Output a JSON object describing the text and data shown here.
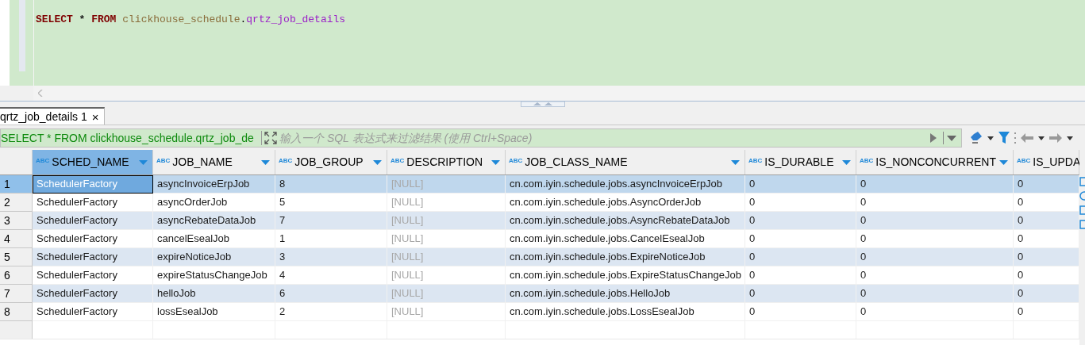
{
  "editor": {
    "tokens": [
      {
        "text": "SELECT ",
        "kind": "keyword"
      },
      {
        "text": "* ",
        "kind": "operator"
      },
      {
        "text": "FROM ",
        "kind": "keyword"
      },
      {
        "text": "clickhouse_schedule",
        "kind": "schema"
      },
      {
        "text": ".",
        "kind": "punct"
      },
      {
        "text": "qrtz_job_details",
        "kind": "table"
      }
    ]
  },
  "result_tabs": [
    {
      "label": "qrtz_job_details 1",
      "selected": true,
      "close": "×"
    }
  ],
  "filter": {
    "query": "SELECT * FROM clickhouse_schedule.qrtz_job_de",
    "placeholder": "输入一个 SQL 表达式来过滤结果 (使用 Ctrl+Space)"
  },
  "table": {
    "columns": [
      {
        "type": "ABC",
        "name": "SCHED_NAME",
        "selected": true
      },
      {
        "type": "ABC",
        "name": "JOB_NAME",
        "selected": false
      },
      {
        "type": "ABC",
        "name": "JOB_GROUP",
        "selected": false
      },
      {
        "type": "ABC",
        "name": "DESCRIPTION",
        "selected": false
      },
      {
        "type": "ABC",
        "name": "JOB_CLASS_NAME",
        "selected": false
      },
      {
        "type": "ABC",
        "name": "IS_DURABLE",
        "selected": false
      },
      {
        "type": "ABC",
        "name": "IS_NONCONCURRENT",
        "selected": false
      },
      {
        "type": "ABC",
        "name": "IS_UPDA",
        "selected": false
      }
    ],
    "rows": [
      {
        "number": "1",
        "selected": true,
        "cells": [
          {
            "text": "SchedulerFactory"
          },
          {
            "text": "asyncInvoiceErpJob"
          },
          {
            "text": "8"
          },
          {
            "text": "[NULL]",
            "kind": "null"
          },
          {
            "text": "cn.com.iyin.schedule.jobs.asyncInvoiceErpJob"
          },
          {
            "text": "0"
          },
          {
            "text": "0"
          },
          {
            "text": "0"
          }
        ]
      },
      {
        "number": "2",
        "selected": false,
        "cells": [
          {
            "text": "SchedulerFactory"
          },
          {
            "text": "asyncOrderJob"
          },
          {
            "text": "5"
          },
          {
            "text": "[NULL]",
            "kind": "null"
          },
          {
            "text": "cn.com.iyin.schedule.jobs.AsyncOrderJob"
          },
          {
            "text": "0"
          },
          {
            "text": "0"
          },
          {
            "text": "0"
          }
        ]
      },
      {
        "number": "3",
        "selected": false,
        "cells": [
          {
            "text": "SchedulerFactory"
          },
          {
            "text": "asyncRebateDataJob"
          },
          {
            "text": "7"
          },
          {
            "text": "[NULL]",
            "kind": "null"
          },
          {
            "text": "cn.com.iyin.schedule.jobs.AsyncRebateDataJob"
          },
          {
            "text": "0"
          },
          {
            "text": "0"
          },
          {
            "text": "0"
          }
        ]
      },
      {
        "number": "4",
        "selected": false,
        "cells": [
          {
            "text": "SchedulerFactory"
          },
          {
            "text": "cancelEsealJob"
          },
          {
            "text": "1"
          },
          {
            "text": "[NULL]",
            "kind": "null"
          },
          {
            "text": "cn.com.iyin.schedule.jobs.CancelEsealJob"
          },
          {
            "text": "0"
          },
          {
            "text": "0"
          },
          {
            "text": "0"
          }
        ]
      },
      {
        "number": "5",
        "selected": false,
        "cells": [
          {
            "text": "SchedulerFactory"
          },
          {
            "text": "expireNoticeJob"
          },
          {
            "text": "3"
          },
          {
            "text": "[NULL]",
            "kind": "null"
          },
          {
            "text": "cn.com.iyin.schedule.jobs.ExpireNoticeJob"
          },
          {
            "text": "0"
          },
          {
            "text": "0"
          },
          {
            "text": "0"
          }
        ]
      },
      {
        "number": "6",
        "selected": false,
        "cells": [
          {
            "text": "SchedulerFactory"
          },
          {
            "text": "expireStatusChangeJob"
          },
          {
            "text": "4"
          },
          {
            "text": "[NULL]",
            "kind": "null"
          },
          {
            "text": "cn.com.iyin.schedule.jobs.ExpireStatusChangeJob"
          },
          {
            "text": "0"
          },
          {
            "text": "0"
          },
          {
            "text": "0"
          }
        ]
      },
      {
        "number": "7",
        "selected": false,
        "cells": [
          {
            "text": "SchedulerFactory"
          },
          {
            "text": "helloJob"
          },
          {
            "text": "6"
          },
          {
            "text": "[NULL]",
            "kind": "null"
          },
          {
            "text": "cn.com.iyin.schedule.jobs.HelloJob"
          },
          {
            "text": "0"
          },
          {
            "text": "0"
          },
          {
            "text": "0"
          }
        ]
      },
      {
        "number": "8",
        "selected": false,
        "cells": [
          {
            "text": "SchedulerFactory"
          },
          {
            "text": "lossEsealJob"
          },
          {
            "text": "2"
          },
          {
            "text": "[NULL]",
            "kind": "null"
          },
          {
            "text": "cn.com.iyin.schedule.jobs.LossEsealJob"
          },
          {
            "text": "0"
          },
          {
            "text": "0"
          },
          {
            "text": "0"
          }
        ]
      }
    ]
  }
}
